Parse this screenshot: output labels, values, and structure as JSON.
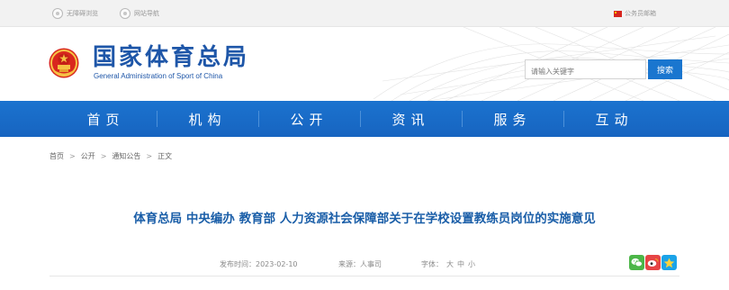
{
  "topbar": {
    "accessible_label": "无障碍浏览",
    "nav_label": "网站导航",
    "gov_account_label": "公务员邮箱"
  },
  "header": {
    "site_name_cn": "国家体育总局",
    "site_name_en": "General Administration of Sport of China"
  },
  "search": {
    "placeholder": "请输入关键字",
    "button_label": "搜索"
  },
  "nav": {
    "items": [
      "首页",
      "机构",
      "公开",
      "资讯",
      "服务",
      "互动"
    ]
  },
  "breadcrumb": {
    "items": [
      "首页",
      "公开",
      "通知公告"
    ],
    "current": "正文",
    "separator": ">"
  },
  "article": {
    "title": "体育总局 中央编办 教育部 人力资源社会保障部关于在学校设置教练员岗位的实施意见",
    "publish_label": "发布时间：",
    "publish_date": "2023-02-10",
    "source_label": "来源：",
    "source": "人事司",
    "font_label": "字体：",
    "font_sizes": [
      "大",
      "中",
      "小"
    ]
  },
  "share": {
    "icons": [
      "wechat-icon",
      "weibo-icon",
      "qzone-icon"
    ]
  },
  "colors": {
    "brand_blue": "#1e56a8",
    "nav_blue": "#1b73cf",
    "title_blue": "#1a5ea8"
  }
}
